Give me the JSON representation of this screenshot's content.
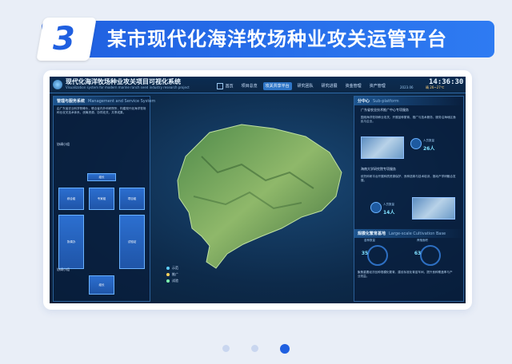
{
  "banner": {
    "number": "3",
    "title": "某市现代化海洋牧场种业攻关运管平台"
  },
  "system": {
    "title": "现代化海洋牧场种业攻关项目可视化系统",
    "subtitle": "Visualization system for modern marine ranch seed industry research project",
    "time": "14:36:30",
    "date": "2023.06",
    "weather": "晴 26~27℃"
  },
  "nav": [
    {
      "label": "首页",
      "icon": "home-icon"
    },
    {
      "label": "项目总览"
    },
    {
      "label": "攻关共享平台",
      "active": true
    },
    {
      "label": "研究团队"
    },
    {
      "label": "研究进展"
    },
    {
      "label": "资金管理"
    },
    {
      "label": "资产管理"
    }
  ],
  "left_panel": {
    "header": "管理与服务系统",
    "header_en": "Management and Service System",
    "intro": "由广东省农业科学院牵头，联合省内外科研院所，构建现代化海洋牧场种业攻关技术体系，统筹资源，协同攻关，共享成果。",
    "section1": "协调小组",
    "section2": "协调小组",
    "boxes": [
      "组长",
      "综合组",
      "专家组",
      "项目组",
      "协调办",
      "试验站"
    ]
  },
  "map_legend": [
    "示范",
    "推广",
    "试验"
  ],
  "right_panel": {
    "header": "分中心",
    "header_en": "Sub-platform",
    "sec1_title": "广东省农业技术推广中心专项服务",
    "sec1_text": "围绕海洋牧场种业攻关，开展苗种繁育、推广与技术服务，服务沿海地区渔民与企业。",
    "sec1_stat_label": "人员数量",
    "sec1_stat_value": "26人",
    "sec2_title": "海南大学研究院专项服务",
    "sec2_text": "依托科研平台开展种质资源保护、良种选育与技术培训，推动产学研融合发展。",
    "sec2_stat_label": "人员数量",
    "sec2_stat_value": "14人",
    "sec3_title": "规模化繁育基地",
    "sec3_title_en": "Large-scale Cultivation Base",
    "gauge1_label": "苗种数量",
    "gauge1_value": "35",
    "gauge2_label": "养殖面积",
    "gauge2_value": "63",
    "sec3_text": "聚焦重要经济品种规模化繁育，建设标准化育苗车间，提升良种覆盖率与产业效益。"
  },
  "pager": {
    "count": 3,
    "active": 2
  }
}
